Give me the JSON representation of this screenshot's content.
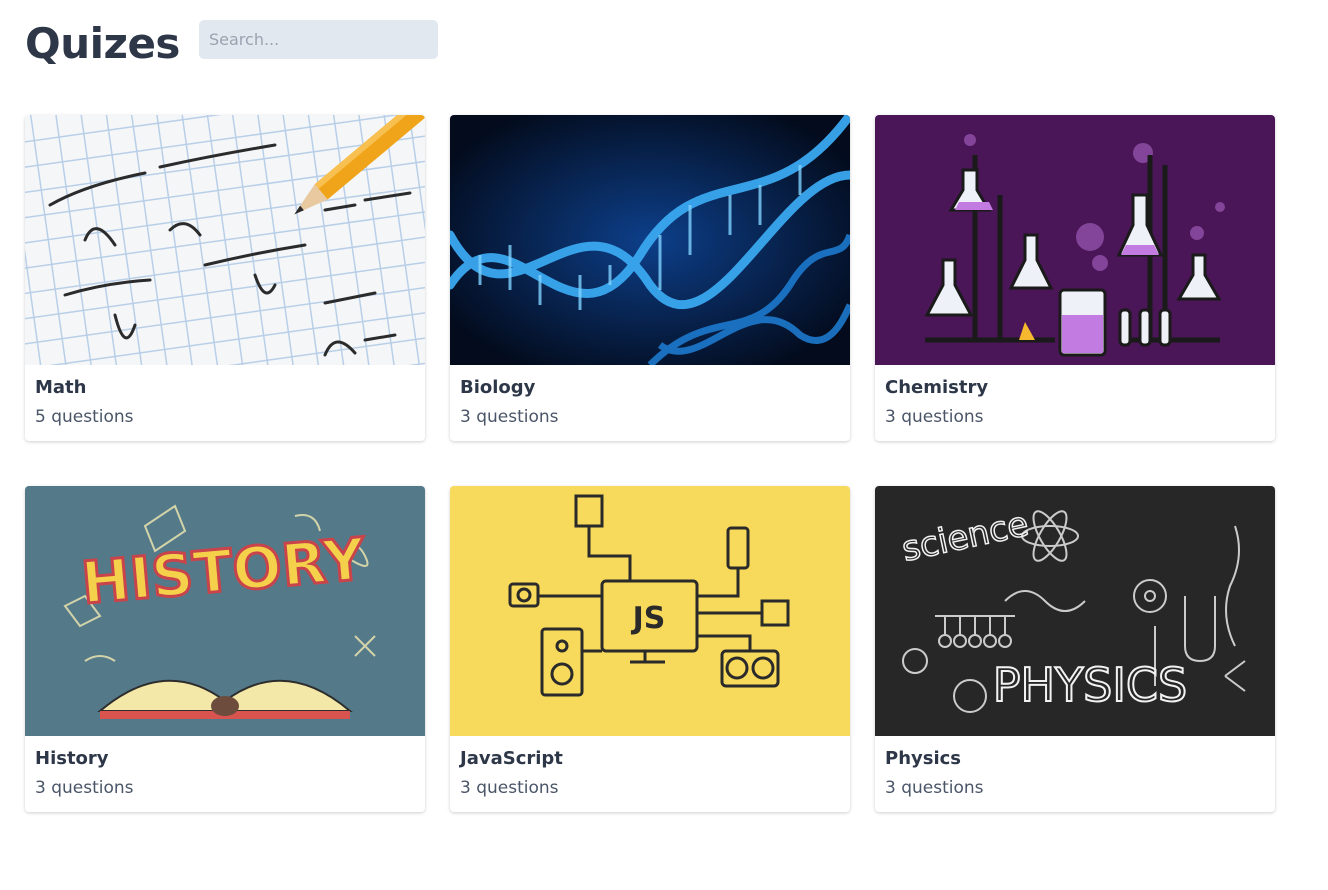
{
  "header": {
    "title": "Quizes",
    "search_placeholder": "Search..."
  },
  "quizzes": [
    {
      "title": "Math",
      "count": "5 questions",
      "image": "math-notebook-pencil"
    },
    {
      "title": "Biology",
      "count": "3 questions",
      "image": "dna-helix"
    },
    {
      "title": "Chemistry",
      "count": "3 questions",
      "image": "lab-flasks"
    },
    {
      "title": "History",
      "count": "3 questions",
      "image": "history-doodle-book"
    },
    {
      "title": "JavaScript",
      "count": "3 questions",
      "image": "js-computer-devices"
    },
    {
      "title": "Physics",
      "count": "3 questions",
      "image": "physics-chalkboard"
    }
  ],
  "images": {
    "history_text": "HISTORY",
    "js_text": "JS",
    "physics_text": "PHYSICS",
    "science_text": "science"
  },
  "colors": {
    "title": "#2d3748",
    "search_bg": "#e2e8f0",
    "biology_bg": "#06152e",
    "chemistry_bg": "#4a1657",
    "history_bg": "#547a8a",
    "javascript_bg": "#f7d95b",
    "physics_bg": "#272727"
  }
}
